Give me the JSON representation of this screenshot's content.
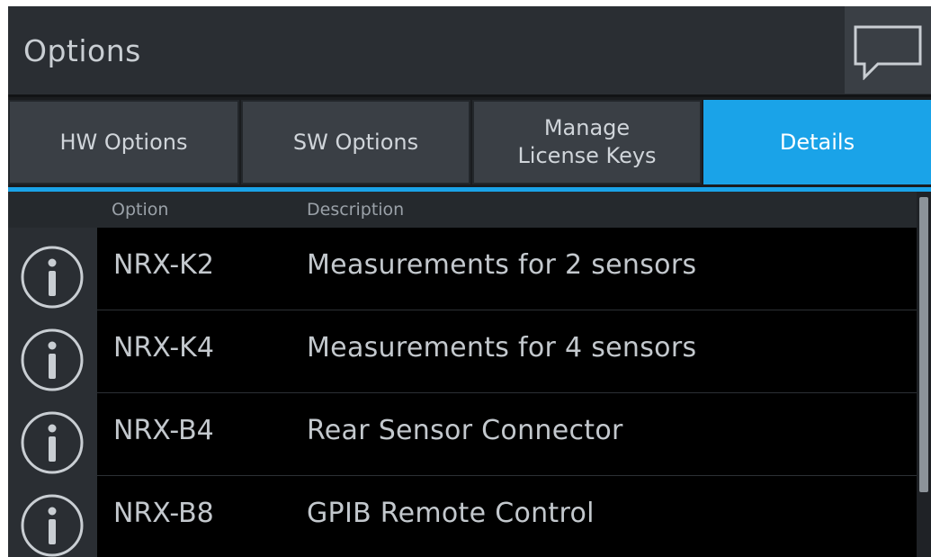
{
  "header": {
    "title": "Options",
    "help_icon": "speech-bubble-icon"
  },
  "tabs": [
    {
      "label": "HW Options",
      "active": false
    },
    {
      "label": "SW Options",
      "active": false
    },
    {
      "label": "Manage\nLicense Keys",
      "active": false
    },
    {
      "label": "Details",
      "active": true
    }
  ],
  "table": {
    "columns": [
      "Option",
      "Description"
    ],
    "rows": [
      {
        "icon": "info-icon",
        "option": "NRX-K2",
        "description": "Measurements for 2 sensors"
      },
      {
        "icon": "info-icon",
        "option": "NRX-K4",
        "description": "Measurements for 4 sensors"
      },
      {
        "icon": "info-icon",
        "option": "NRX-B4",
        "description": "Rear Sensor Connector"
      },
      {
        "icon": "info-icon",
        "option": "NRX-B8",
        "description": "GPIB Remote Control"
      }
    ]
  },
  "colors": {
    "accent": "#1aa3e8",
    "background": "#1f2226",
    "row_background": "#000000",
    "text": "#c3c8cd"
  }
}
